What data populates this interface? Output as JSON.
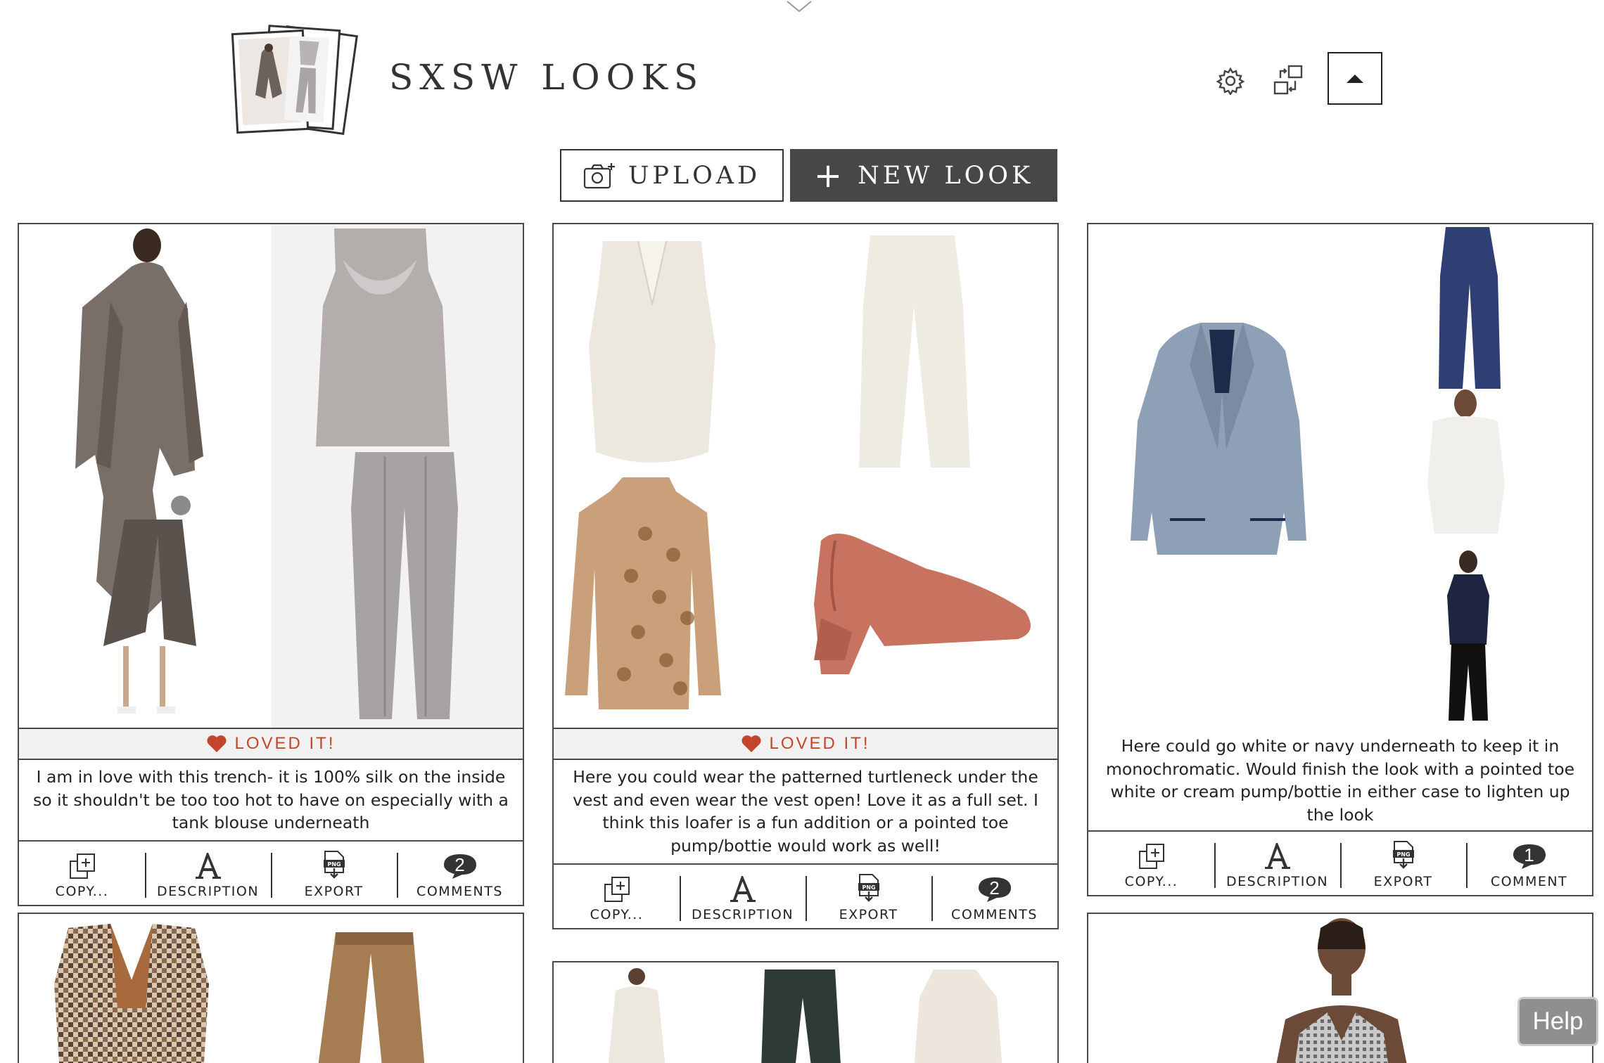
{
  "board": {
    "title": "SXSW LOOKS"
  },
  "toolbar": {
    "upload_label": "UPLOAD",
    "new_look_label": "NEW LOOK"
  },
  "looks": [
    {
      "loved_label": "LOVED IT!",
      "description": "I am in love with this trench- it is 100% silk on the inside so it shouldn't be too too hot to have on especially with a tank blouse underneath",
      "actions": {
        "copy": "COPY...",
        "description": "DESCRIPTION",
        "export": "EXPORT",
        "comments": "COMMENTS",
        "comment_count": "2"
      }
    },
    {
      "loved_label": "LOVED IT!",
      "description": "Here you could wear the patterned turtleneck under the vest and even wear the vest open! Love it as a full set. I think this loafer is a fun addition or a pointed toe pump/bottie would work as well!",
      "actions": {
        "copy": "COPY...",
        "description": "DESCRIPTION",
        "export": "EXPORT",
        "comments": "COMMENTS",
        "comment_count": "2"
      }
    },
    {
      "description": "Here could go white or navy underneath to keep it in monochromatic. Would finish the look with a pointed toe white or cream pump/bottie in either case to lighten up the look",
      "actions": {
        "copy": "COPY...",
        "description": "DESCRIPTION",
        "export": "EXPORT",
        "comments": "COMMENT",
        "comment_count": "1"
      }
    }
  ],
  "help_label": "Help",
  "colors": {
    "loved": "#c2462b",
    "new_look_bg": "#474747",
    "border": "#4a4a4a",
    "bubble": "#333333"
  },
  "icons": [
    "gear-icon",
    "swap-icon",
    "caret-up-icon",
    "camera-plus-icon",
    "plus-icon",
    "heart-icon",
    "copy-icon",
    "font-a-icon",
    "png-export-icon",
    "comment-bubble-icon"
  ]
}
